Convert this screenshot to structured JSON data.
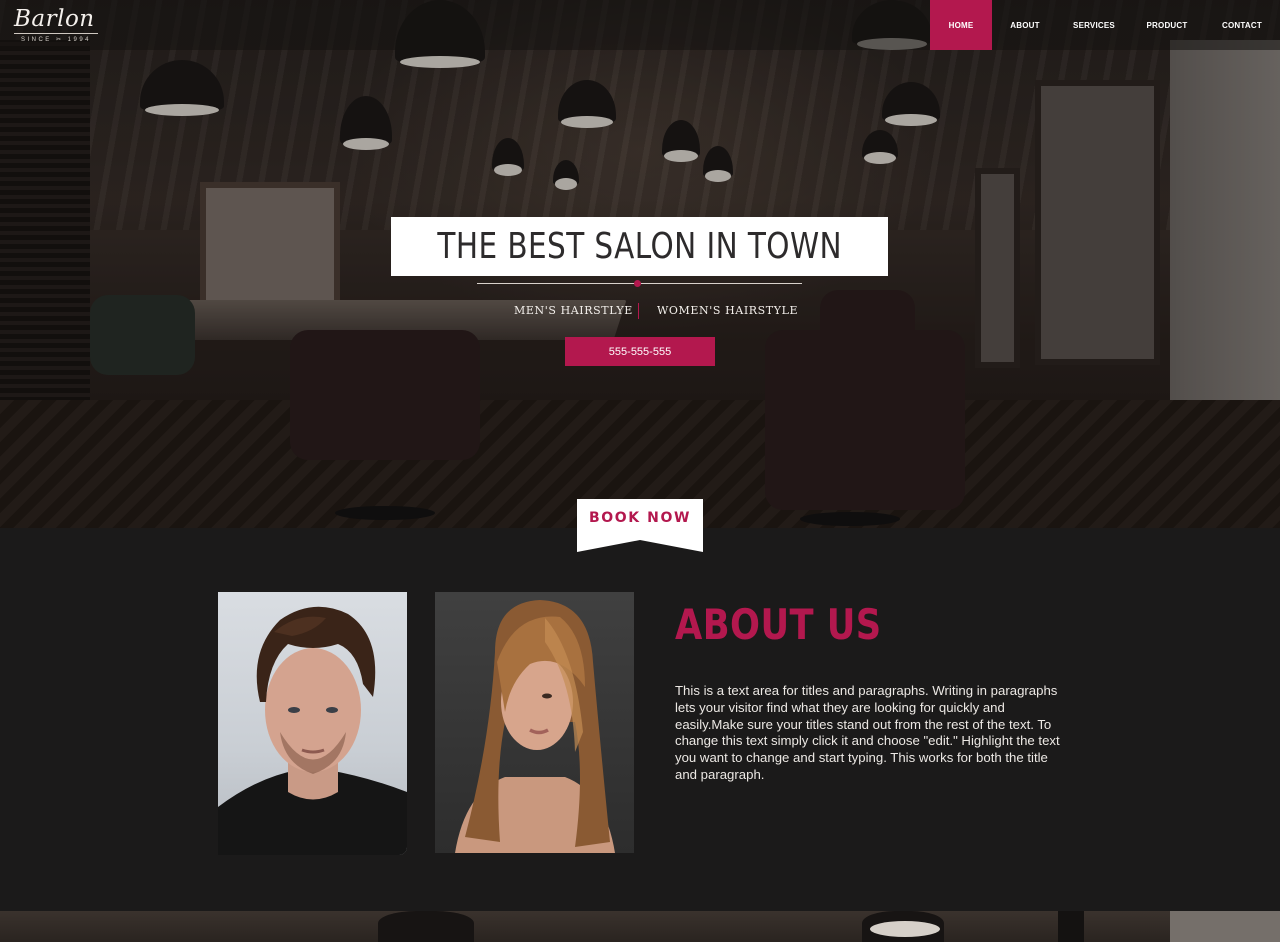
{
  "brand": {
    "logo_text": "Barlon",
    "logo_sub": "SINCE ✂ 1994"
  },
  "nav": {
    "items": [
      {
        "label": "HOME",
        "active": true
      },
      {
        "label": "ABOUT",
        "active": false
      },
      {
        "label": "SERVICES",
        "active": false
      },
      {
        "label": "PRODUCT",
        "active": false
      },
      {
        "label": "CONTACT",
        "active": false
      }
    ]
  },
  "hero": {
    "title": "THE BEST SALON IN TOWN",
    "subtitle_left": "MEN'S HAIRSTLYE",
    "subtitle_right": "WOMEN'S HAIRSTYLE",
    "phone": "555-555-555"
  },
  "book_now": {
    "label": "BOOK NOW"
  },
  "about": {
    "title": "ABOUT US",
    "paragraph": "This is a text area for titles and paragraphs. Writing in paragraphs lets your visitor find what they are looking for quickly and easily.Make sure your titles stand out from the rest of the text. To change this text simply click it and choose \"edit.\" Highlight the text you want to change and start typing. This works for both the title and paragraph."
  },
  "colors": {
    "accent": "#b3184e",
    "background": "#1b1a1a",
    "white": "#ffffff"
  }
}
